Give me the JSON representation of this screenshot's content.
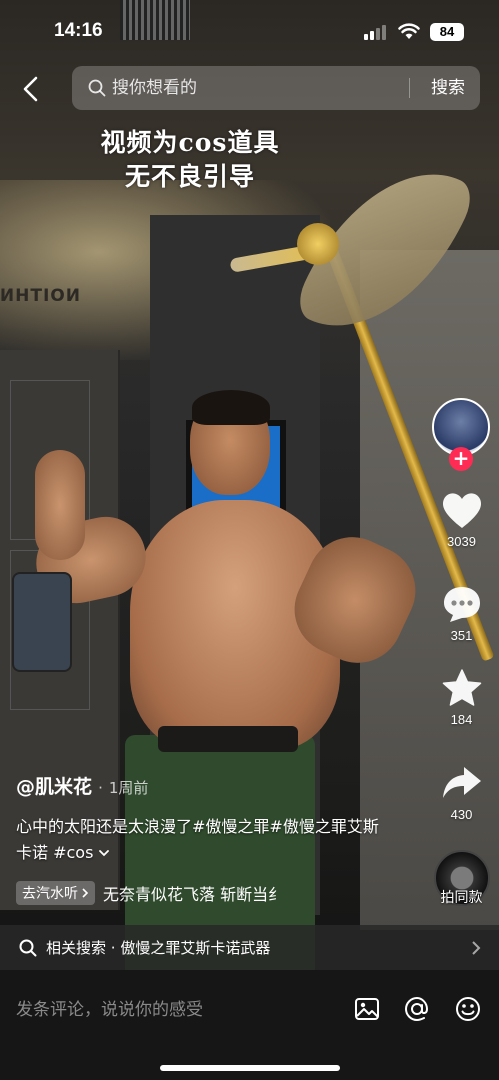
{
  "status_bar": {
    "time": "14:16",
    "battery": "84",
    "signal_icon": "signal-icon",
    "wifi_icon": "wifi-icon"
  },
  "header": {
    "back_icon": "chevron-left-icon",
    "search_placeholder": "搜你想看的",
    "search_button": "搜索",
    "search_icon": "search-icon"
  },
  "video": {
    "caption_line1": "视频为cos道具",
    "caption_line2": "无不良引导"
  },
  "rail": {
    "follow": "+",
    "likes": "3039",
    "comments": "351",
    "favorites": "184",
    "shares": "430",
    "same_style": "拍同款",
    "like_icon": "heart-icon",
    "comment_icon": "comment-bubble-icon",
    "favorite_icon": "star-icon",
    "share_icon": "share-arrow-icon"
  },
  "post": {
    "author": "@肌米花",
    "time": "1周前",
    "separator": "·",
    "description": "心中的太阳还是太浪漫了#傲慢之罪#傲慢之罪艾斯卡诺 #cos",
    "music_tag": "去汽水听",
    "music_title": "无奈青似花飞落 斩断当纟"
  },
  "related": {
    "label": "相关搜索",
    "separator": "·",
    "query": "傲慢之罪艾斯卡诺武器"
  },
  "comment_bar": {
    "placeholder": "发条评论，说说你的感受",
    "image_icon": "image-icon",
    "mention_icon": "at-mention-icon",
    "emoji_icon": "emoji-icon"
  },
  "colors": {
    "accent": "#fe2c55",
    "overlay": "#161616"
  }
}
